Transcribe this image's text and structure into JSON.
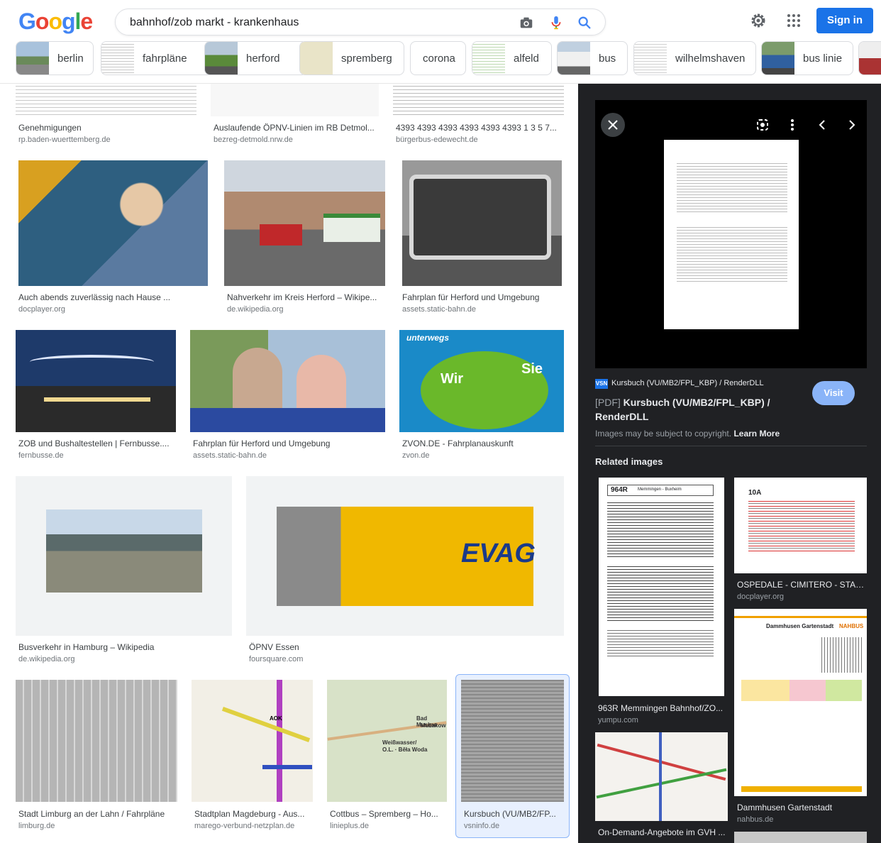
{
  "search": {
    "query": "bahnhof/zob markt - krankenhaus"
  },
  "header": {
    "signin_label": "Sign in"
  },
  "chips": [
    {
      "label": "berlin"
    },
    {
      "label": "fahrpläne"
    },
    {
      "label": "herford"
    },
    {
      "label": "spremberg"
    },
    {
      "label": "corona"
    },
    {
      "label": "alfeld"
    },
    {
      "label": "bus"
    },
    {
      "label": "wilhelmshaven"
    },
    {
      "label": "bus linie"
    }
  ],
  "results": [
    {
      "caption": "Genehmigungen",
      "source": "rp.baden-wuerttemberg.de"
    },
    {
      "caption": "Auslaufende ÖPNV-Linien im RB Detmol...",
      "source": "bezreg-detmold.nrw.de"
    },
    {
      "caption": "4393 4393 4393 4393 4393 4393 1 3 5 7...",
      "source": "bürgerbus-edewecht.de"
    },
    {
      "caption": "Auch abends zuverlässig nach Hause ...",
      "source": "docplayer.org"
    },
    {
      "caption": "Nahverkehr im Kreis Herford – Wikipe...",
      "source": "de.wikipedia.org"
    },
    {
      "caption": "Fahrplan für Herford und Umgebung",
      "source": "assets.static-bahn.de"
    },
    {
      "caption": "ZOB und Bushaltestellen | Fernbusse....",
      "source": "fernbusse.de"
    },
    {
      "caption": "Fahrplan für Herford und Umgebung",
      "source": "assets.static-bahn.de"
    },
    {
      "caption": "ZVON.DE - Fahrplanauskunft",
      "source": "zvon.de"
    },
    {
      "caption": "Busverkehr in Hamburg – Wikipedia",
      "source": "de.wikipedia.org"
    },
    {
      "caption": "ÖPNV Essen",
      "source": "foursquare.com"
    },
    {
      "caption": "Stadt Limburg an der Lahn / Fahrpläne",
      "source": "limburg.de"
    },
    {
      "caption": "Stadtplan Magdeburg - Aus...",
      "source": "marego-verbund-netzplan.de"
    },
    {
      "caption": "Cottbus – Spremberg – Ho...",
      "source": "linieplus.de"
    },
    {
      "caption": "Kursbuch (VU/MB2/FP...",
      "source": "vsninfo.de"
    }
  ],
  "panel": {
    "site_badge": "VSN",
    "site_name": "Kursbuch (VU/MB2/FPL_KBP) / RenderDLL",
    "title_prefix": "[PDF]",
    "title_line1": "Kursbuch (VU/MB2/FPL_KBP) /",
    "title_line2": "RenderDLL",
    "visit_label": "Visit",
    "copyright": "Images may be subject to copyright.",
    "learn_more": "Learn More",
    "related_heading": "Related images",
    "related": [
      {
        "caption": "963R Memmingen Bahnhof/ZO...",
        "source": "yumpu.com"
      },
      {
        "caption": "OSPEDALE - CIMITERO - STAZI...",
        "source": "docplayer.org"
      },
      {
        "caption": "Dammhusen Gartenstadt",
        "source": "nahbus.de"
      },
      {
        "caption": "On-Demand-Angebote im GVH ...",
        "source": ""
      }
    ],
    "doc_texts": {
      "r1": "964R",
      "r1b": "Memmingen - Buxheim",
      "r2": "10A",
      "r3": "Dammhusen Gartenstadt",
      "r3b": "NAHBUS"
    }
  },
  "image_texts": {
    "evag": "EVAG",
    "zvon_1": "unterwegs",
    "zvon_2": "Wir",
    "zvon_3": "Sie",
    "map1": "AOK",
    "map2": "Weißwasser/",
    "map3": "O.L. · Běła Woda",
    "map4": "Bad Muskau",
    "map5": "Mužakow"
  }
}
